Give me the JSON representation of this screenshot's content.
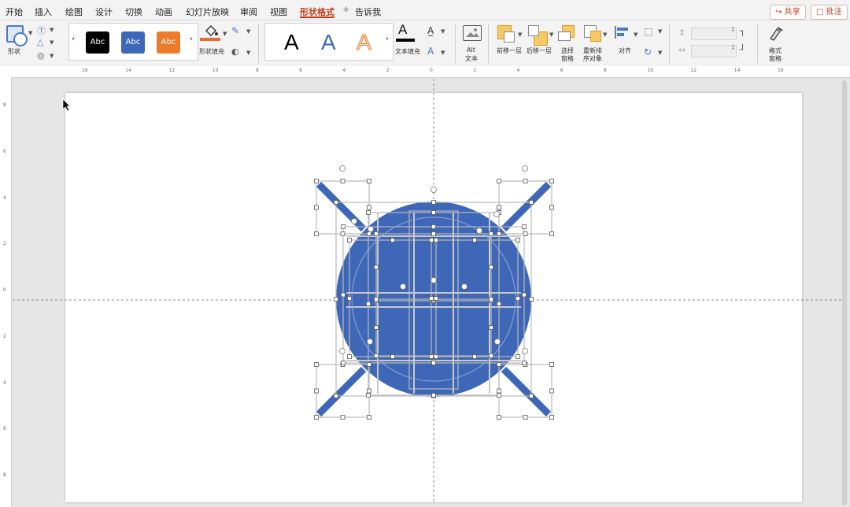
{
  "menu": {
    "tabs": [
      "开始",
      "插入",
      "绘图",
      "设计",
      "切换",
      "动画",
      "幻灯片放映",
      "审阅",
      "视图",
      "形状格式"
    ],
    "tell_me": "告诉我",
    "share_label": "共享",
    "comment_label": "批注"
  },
  "ribbon": {
    "shapes_label": "形状",
    "style_swatches": [
      {
        "label": "Abc",
        "color": "#000000"
      },
      {
        "label": "Abc",
        "color": "#3f67b8"
      },
      {
        "label": "Abc",
        "color": "#ee7a2c"
      }
    ],
    "shape_fill_label": "形状填充",
    "wordart": [
      {
        "label": "A",
        "style": "black"
      },
      {
        "label": "A",
        "style": "blue"
      },
      {
        "label": "A",
        "style": "orange-outline"
      }
    ],
    "text_fill_label": "文本填充",
    "alt_text_label_1": "Alt",
    "alt_text_label_2": "文本",
    "bring_forward_label": "前移一层",
    "send_backward_label": "后移一层",
    "selection_pane_label_1": "选择",
    "selection_pane_label_2": "窗格",
    "reorder_label_1": "重新排",
    "reorder_label_2": "序对象",
    "align_label": "对齐",
    "format_pane_label_1": "格式",
    "format_pane_label_2": "窗格"
  },
  "colors": {
    "accent_red": "#c43b1c",
    "shape_blue": "#3f67b8",
    "fill_bar_orange": "#e86d2a"
  },
  "ruler": {
    "top": [
      "16",
      "14",
      "12",
      "10",
      "8",
      "6",
      "4",
      "2",
      "0",
      "2",
      "4",
      "6",
      "8",
      "10",
      "12",
      "14",
      "16"
    ],
    "left": [
      "8",
      "6",
      "4",
      "2",
      "0",
      "2",
      "4",
      "6",
      "8"
    ]
  }
}
